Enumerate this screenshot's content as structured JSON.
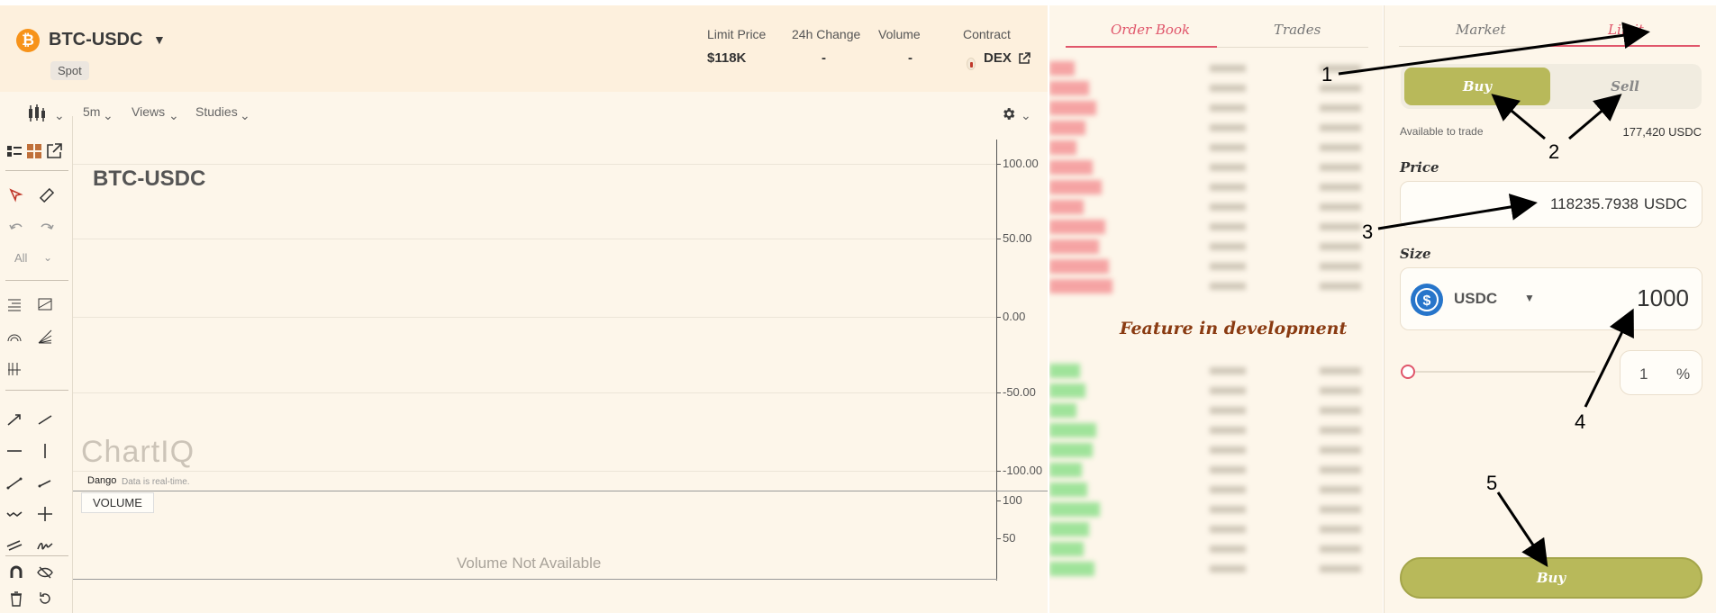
{
  "header": {
    "logo_glyph": "₿",
    "pair": "BTC-USDC",
    "market_type": "Spot",
    "stats": [
      {
        "label": "Limit Price",
        "value": "$118K"
      },
      {
        "label": "24h Change",
        "value": "-"
      },
      {
        "label": "Volume",
        "value": "-"
      },
      {
        "label": "Contract",
        "value": "DEX"
      }
    ]
  },
  "chart_toolbar": {
    "interval": "5m",
    "views": "Views",
    "studies": "Studies"
  },
  "chart": {
    "symbol_label": "BTC-USDC",
    "watermark": "ChartIQ",
    "source": "Dango",
    "realtime_note": "Data is real-time.",
    "volume_label": "VOLUME",
    "volume_na": "Volume Not Available",
    "y_ticks": [
      "100.00",
      "50.00",
      "0.00",
      "-50.00",
      "-100.00"
    ],
    "volume_ticks": [
      "100",
      "50"
    ],
    "drawing_filter": "All"
  },
  "orderbook": {
    "tabs": [
      "Order Book",
      "Trades"
    ],
    "active_tab": "Order Book",
    "overlay": "Feature in development",
    "ask_color": "#f5a3a3",
    "bid_color": "#9fe39a"
  },
  "trade": {
    "tabs": [
      "Market",
      "Limit"
    ],
    "active_tab": "Limit",
    "buy_label": "Buy",
    "sell_label": "Sell",
    "available_label": "Available to trade",
    "available_value": "177,420 USDC",
    "price_label": "Price",
    "price_value": "118235.7938",
    "price_unit": "USDC",
    "size_label": "Size",
    "size_token": "USDC",
    "size_value": "1000",
    "slider_percent": "1",
    "percent_sign": "%",
    "submit_label": "Buy",
    "accent": "#b8b95a",
    "active_tab_color": "#e0566b"
  },
  "annotations": [
    "1",
    "2",
    "3",
    "4",
    "5"
  ]
}
